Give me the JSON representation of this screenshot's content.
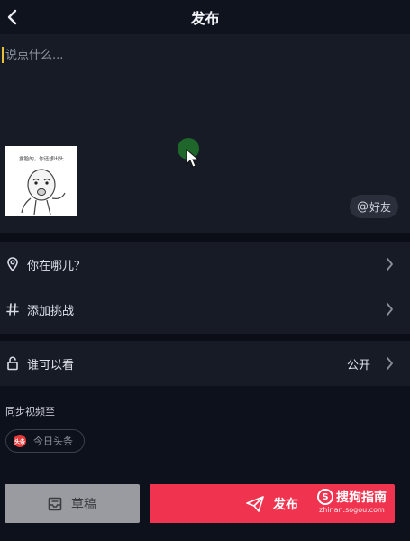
{
  "header": {
    "title": "发布"
  },
  "compose": {
    "caption_placeholder": "说点什么...",
    "thumbnail_caption": "露脸的，你还想出头",
    "mention_at": "@",
    "mention_label": "好友"
  },
  "location": {
    "label": "你在哪儿？"
  },
  "challenge": {
    "label": "添加挑战"
  },
  "privacy": {
    "label": "谁可以看",
    "value": "公开"
  },
  "sync": {
    "title": "同步视频至",
    "platform_logo": "头条",
    "platform_label": "今日头条"
  },
  "actions": {
    "draft_label": "草稿",
    "publish_label": "发布"
  },
  "watermark": {
    "brand": "搜狗指南",
    "url": "zhinan.sogou.com"
  },
  "colors": {
    "accent": "#f0334e",
    "cursor": "#e8c23c",
    "background": "#0f131d"
  }
}
